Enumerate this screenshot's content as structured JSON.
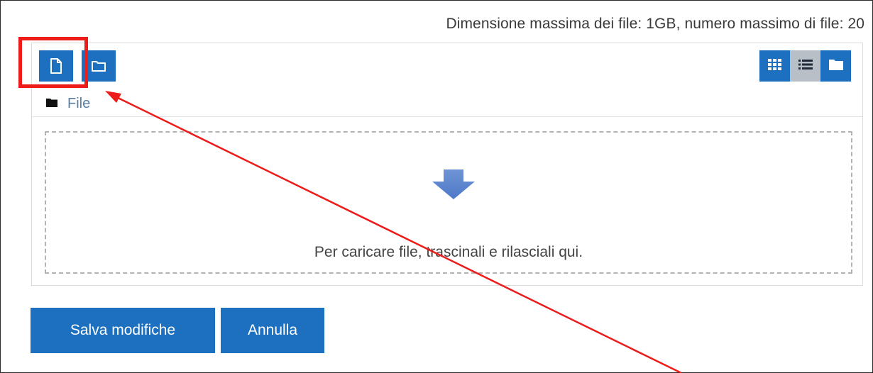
{
  "limits_text": "Dimensione massima dei file: 1GB, numero massimo di file: 20",
  "toolbar": {
    "add_file_icon": "file-icon",
    "create_folder_icon": "folder-icon",
    "views": [
      {
        "name": "icons-view",
        "icon": "grid-icon",
        "active": false
      },
      {
        "name": "list-view",
        "icon": "list-icon",
        "active": true
      },
      {
        "name": "tree-view",
        "icon": "folder-icon",
        "active": false
      }
    ]
  },
  "breadcrumb": {
    "label": "File"
  },
  "dropzone": {
    "text": "Per caricare file, trascinali e rilasciali qui."
  },
  "actions": {
    "save_label": "Salva modifiche",
    "cancel_label": "Annulla"
  },
  "colors": {
    "primary": "#1d6fc0",
    "active_view": "#b9bfc6",
    "annotation": "#ee1b1b",
    "arrow": "#5b86d8"
  }
}
